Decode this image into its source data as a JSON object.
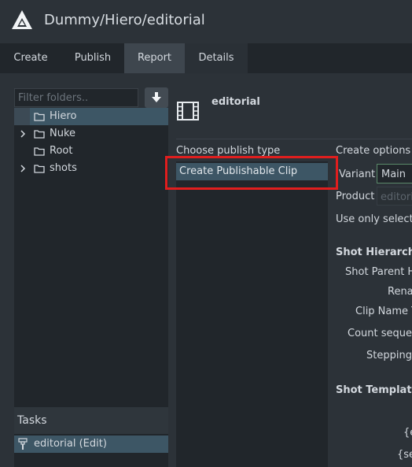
{
  "header": {
    "title": "Dummy/Hiero/editorial"
  },
  "tabs": [
    {
      "label": "Create",
      "active": false
    },
    {
      "label": "Publish",
      "active": false
    },
    {
      "label": "Report",
      "active": true
    },
    {
      "label": "Details",
      "active": false
    }
  ],
  "folders": {
    "filter_placeholder": "Filter folders..",
    "items": [
      {
        "label": "Hiero",
        "selected": true,
        "expandable": false
      },
      {
        "label": "Nuke",
        "selected": false,
        "expandable": true
      },
      {
        "label": "Root",
        "selected": false,
        "expandable": false
      },
      {
        "label": "shots",
        "selected": false,
        "expandable": true
      }
    ]
  },
  "tasks": {
    "title": "Tasks",
    "items": [
      {
        "label": "editorial (Edit)",
        "selected": true
      }
    ]
  },
  "product": {
    "name": "editorial"
  },
  "publish_types": {
    "title": "Choose publish type",
    "items": [
      {
        "label": "Create Publishable Clip",
        "selected": true
      }
    ]
  },
  "options": {
    "title": "Create options",
    "variant_label": "Variant",
    "variant_value": "Main",
    "product_label": "Product",
    "product_value": "editoria",
    "use_only_label": "Use only selecte"
  },
  "shot_hierarchy": {
    "title": "Shot Hierarchy",
    "rows": [
      "Shot Parent H",
      "Rena",
      "Clip Name Te",
      "Count sequen",
      "Stepping"
    ]
  },
  "shot_template": {
    "title": "Shot Template",
    "rows": [
      "{e",
      "{se"
    ]
  },
  "colors": {
    "accent_selection": "#3d5665",
    "highlight_border": "#e01e1e",
    "background": "#2c3238",
    "panel": "#21262b"
  }
}
